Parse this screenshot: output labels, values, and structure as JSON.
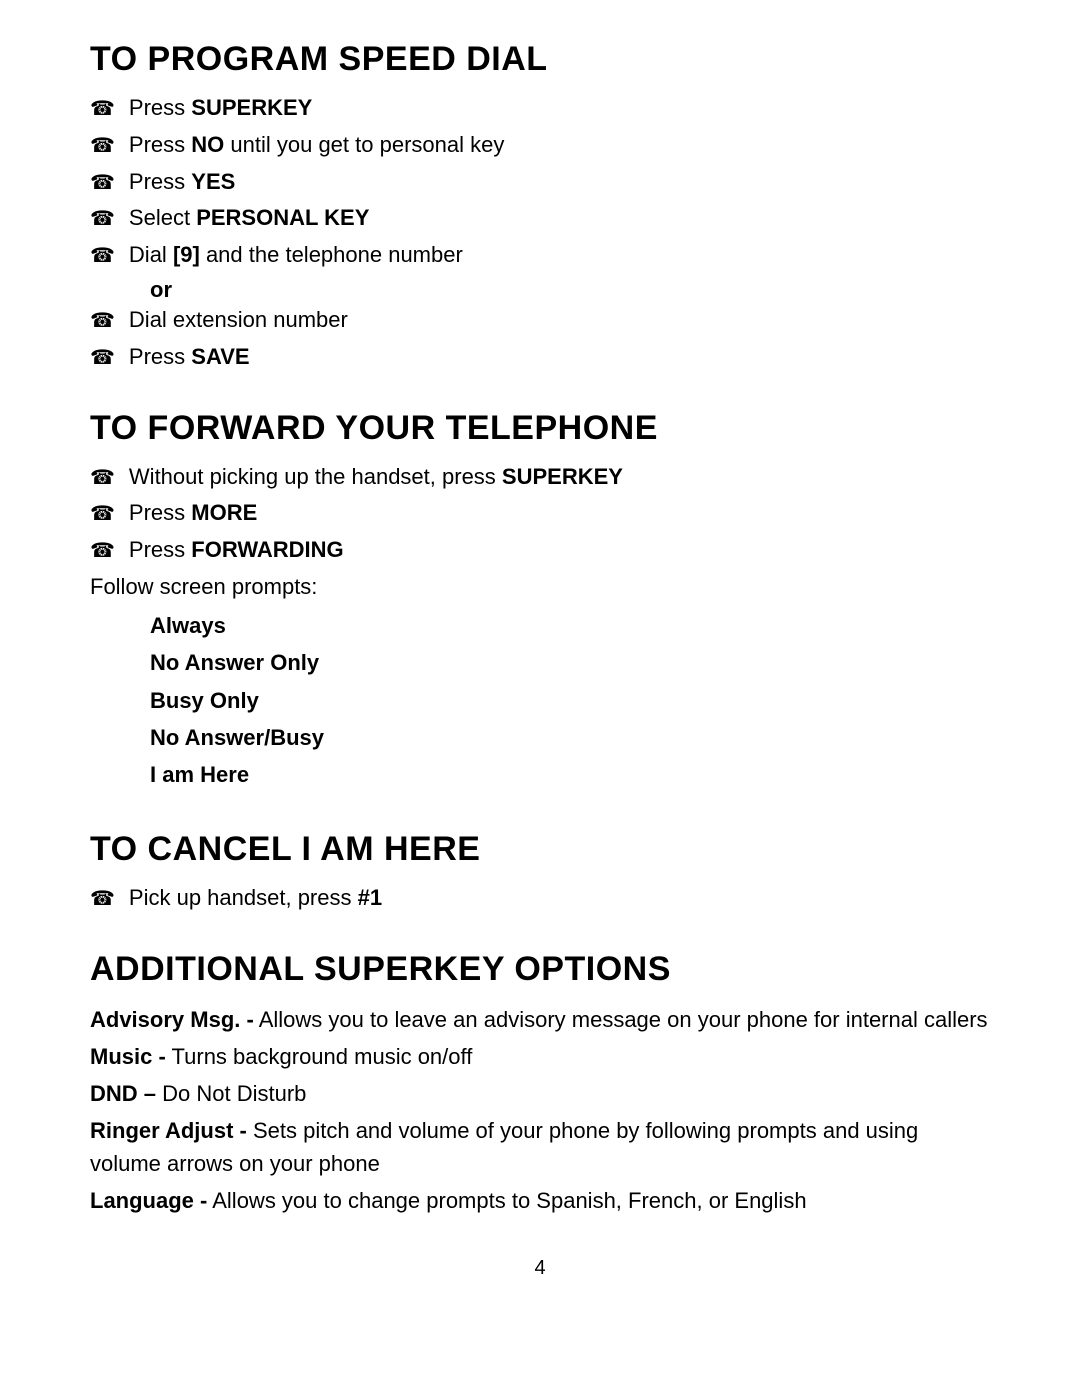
{
  "sections": {
    "speed_dial": {
      "title": "TO PROGRAM SPEED DIAL",
      "steps": [
        {
          "text": "Press ",
          "bold": "SUPERKEY",
          "rest": ""
        },
        {
          "text": "Press ",
          "bold": "NO",
          "rest": " until you get to personal key"
        },
        {
          "text": "Press ",
          "bold": "YES",
          "rest": ""
        },
        {
          "text": "Select ",
          "bold": "PERSONAL KEY",
          "rest": ""
        },
        {
          "text": "Dial ",
          "bold": "[9]",
          "rest": " and the telephone number"
        },
        {
          "text": "or",
          "bold": "",
          "rest": "",
          "indent": true
        },
        {
          "text": " Dial extension number",
          "bold": "",
          "rest": "",
          "indent_step": true
        },
        {
          "text": "Press ",
          "bold": "SAVE",
          "rest": ""
        }
      ]
    },
    "forward": {
      "title": "TO FORWARD YOUR TELEPHONE",
      "steps": [
        {
          "text": "Without picking up the handset, press ",
          "bold": "SUPERKEY",
          "rest": ""
        },
        {
          "text": "Press ",
          "bold": "MORE",
          "rest": ""
        },
        {
          "text": "Press ",
          "bold": "FORWARDING",
          "rest": ""
        }
      ],
      "follow_label": "Follow screen prompts:",
      "options": [
        "Always",
        "No Answer Only",
        "Busy Only",
        "No Answer/Busy",
        "I am Here"
      ]
    },
    "cancel": {
      "title": "TO CANCEL I AM HERE",
      "steps": [
        {
          "text": "Pick up handset, press ",
          "bold": "#1",
          "rest": ""
        }
      ]
    },
    "additional": {
      "title": "ADDITIONAL SUPERKEY OPTIONS",
      "items": [
        {
          "bold_label": "Advisory Msg.",
          "dash": " -",
          "rest": " Allows you to leave an advisory message on your phone for internal callers"
        },
        {
          "bold_label": "Music",
          "dash": " -",
          "rest": " Turns background music on/off"
        },
        {
          "bold_label": "DND –",
          "dash": "",
          "rest": " Do Not Disturb"
        },
        {
          "bold_label": "Ringer Adjust",
          "dash": " -",
          "rest": " Sets pitch and volume of your phone by following prompts and using volume arrows on your phone"
        },
        {
          "bold_label": "Language",
          "dash": " -",
          "rest": " Allows you to change prompts to Spanish, French, or English"
        }
      ]
    }
  },
  "page_number": "4",
  "phone_icon": "☏"
}
